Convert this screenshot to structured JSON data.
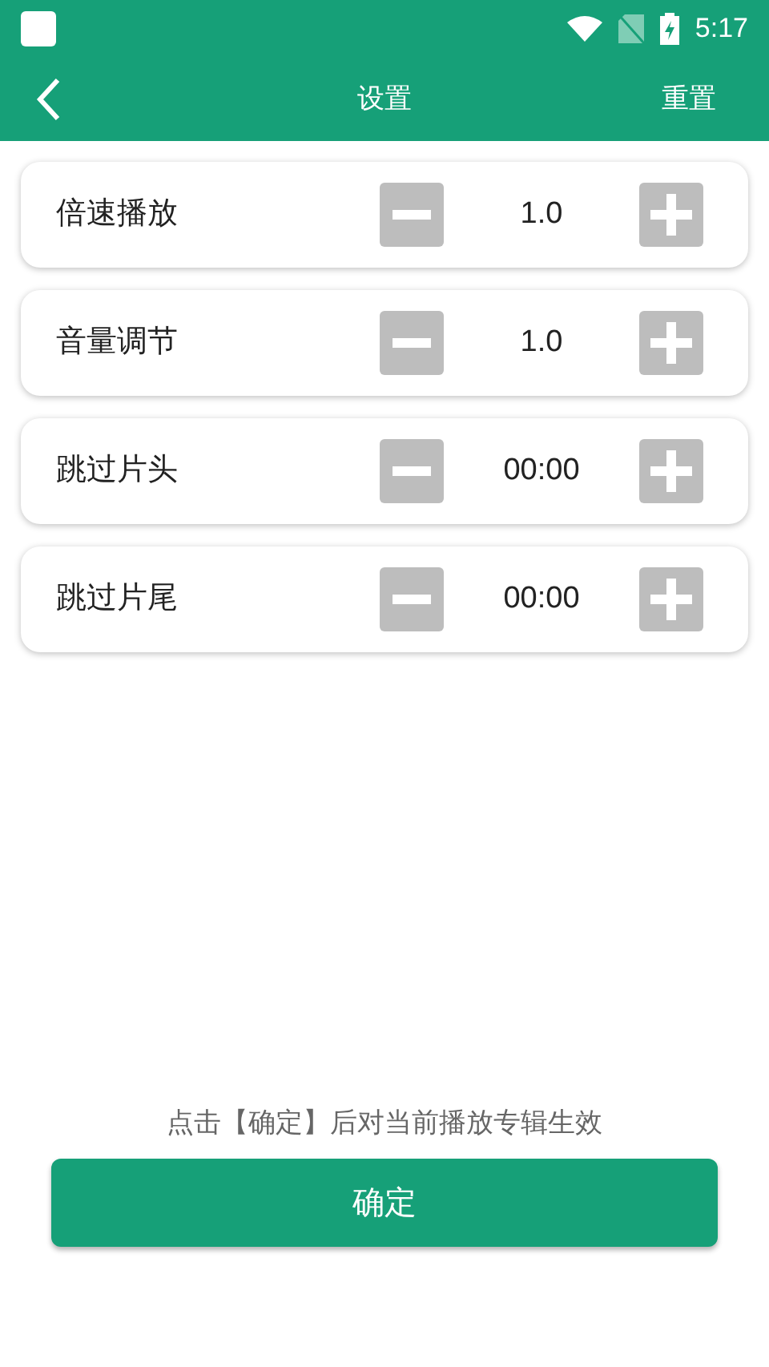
{
  "status_bar": {
    "time": "5:17"
  },
  "header": {
    "title": "设置",
    "action": "重置"
  },
  "settings": [
    {
      "label": "倍速播放",
      "value": "1.0"
    },
    {
      "label": "音量调节",
      "value": "1.0"
    },
    {
      "label": "跳过片头",
      "value": "00:00"
    },
    {
      "label": "跳过片尾",
      "value": "00:00"
    }
  ],
  "hint": "点击【确定】后对当前播放专辑生效",
  "confirm_button": "确定"
}
